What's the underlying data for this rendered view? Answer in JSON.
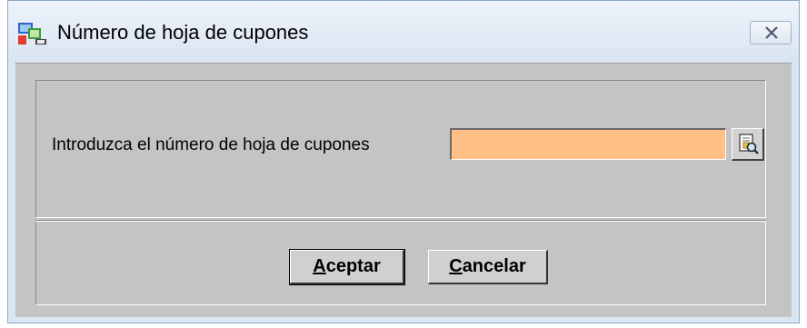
{
  "window": {
    "title": "Número de hoja de cupones"
  },
  "form": {
    "prompt_label": "Introduzca el número de hoja de cupones",
    "coupon_input": {
      "value": "",
      "placeholder": ""
    },
    "lookup_icon": "search-document-icon"
  },
  "buttons": {
    "accept": {
      "mnemonic": "A",
      "rest": "ceptar"
    },
    "cancel": {
      "mnemonic": "C",
      "rest": "ancelar"
    }
  },
  "colors": {
    "input_background": "#ffbf86",
    "dialog_background": "#c4c4c4",
    "titlebar": "#dbe6f3"
  }
}
